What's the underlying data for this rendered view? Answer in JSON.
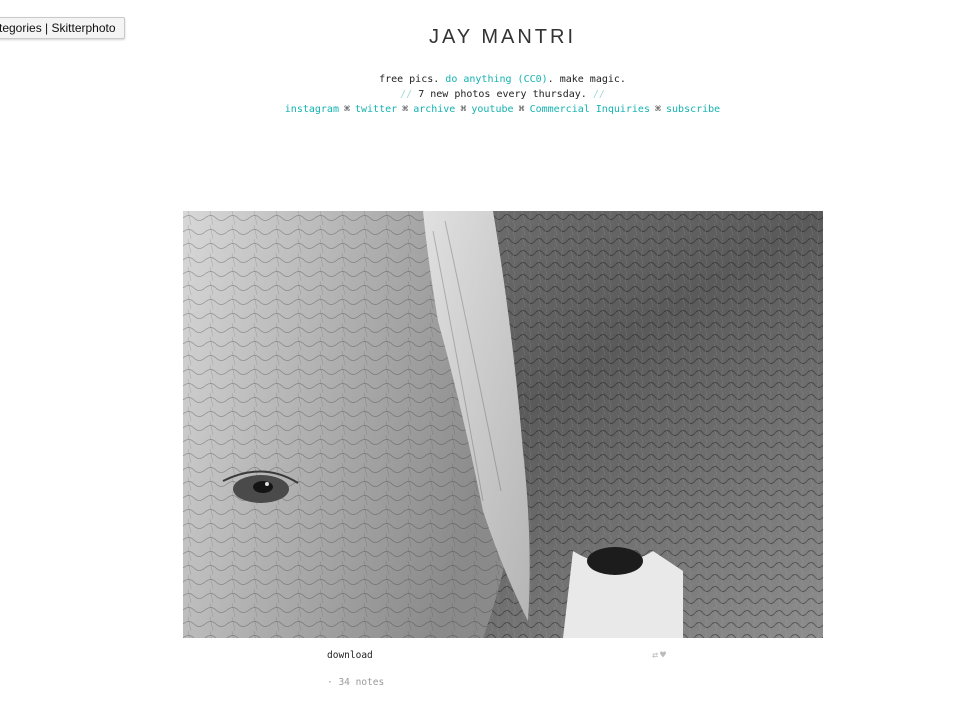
{
  "tooltip": {
    "text": "tegories | Skitterphoto"
  },
  "header": {
    "title": "JAY MANTRI",
    "desc1_pre": "free pics. ",
    "desc1_link": "do anything (CC0)",
    "desc1_post": ". make magic.",
    "desc2_slash_open": "//",
    "desc2_text": " 7 new photos every thursday. ",
    "desc2_slash_close": "//",
    "separator": "⌘",
    "links": [
      "instagram",
      "twitter",
      "archive",
      "youtube",
      "Commercial Inquiries",
      "subscribe"
    ]
  },
  "post": {
    "image": {
      "subject": "black-and-white close-up of two elephants' wrinkled skin",
      "tones": {
        "light": "#cfcfcf",
        "mid": "#8c8c8c",
        "dark": "#3c3c3c",
        "bg": "#e8e8e8"
      }
    },
    "caption": "download",
    "actions": {
      "reblog_icon": "reblog-icon",
      "like_icon": "heart-icon"
    },
    "notes": "· 34 notes"
  }
}
